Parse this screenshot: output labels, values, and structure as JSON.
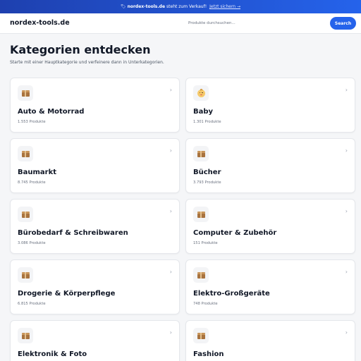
{
  "banner": {
    "domain": "nordex-tools.de",
    "text": "steht zum Verkauf!",
    "link": "Jetzt sichern →"
  },
  "header": {
    "logo": "nordex-tools.de",
    "search_placeholder": "Produkte durchsuchen...",
    "search_button": "Search"
  },
  "page": {
    "title": "Kategorien entdecken",
    "subtitle": "Starte mit einer Hauptkategorie und verfeinere dann in Unterkategorien."
  },
  "categories": [
    {
      "name": "Auto & Motorrad",
      "count": "1.553 Produkte",
      "icon": "package-icon"
    },
    {
      "name": "Baby",
      "count": "1.301 Produkte",
      "icon": "baby-icon"
    },
    {
      "name": "Baumarkt",
      "count": "8.745 Produkte",
      "icon": "package-icon"
    },
    {
      "name": "Bücher",
      "count": "3.793 Produkte",
      "icon": "package-icon"
    },
    {
      "name": "Bürobedarf & Schreibwaren",
      "count": "3.086 Produkte",
      "icon": "package-icon"
    },
    {
      "name": "Computer & Zubehör",
      "count": "151 Produkte",
      "icon": "package-icon"
    },
    {
      "name": "Drogerie & Körperpflege",
      "count": "6.815 Produkte",
      "icon": "package-icon"
    },
    {
      "name": "Elektro-Großgeräte",
      "count": "748 Produkte",
      "icon": "package-icon"
    },
    {
      "name": "Elektronik & Foto",
      "count": "",
      "icon": "package-icon"
    },
    {
      "name": "Fashion",
      "count": "",
      "icon": "package-icon"
    }
  ],
  "colors": {
    "accent": "#2563eb",
    "banner": "#1e40af",
    "background": "#f5f6f8"
  }
}
